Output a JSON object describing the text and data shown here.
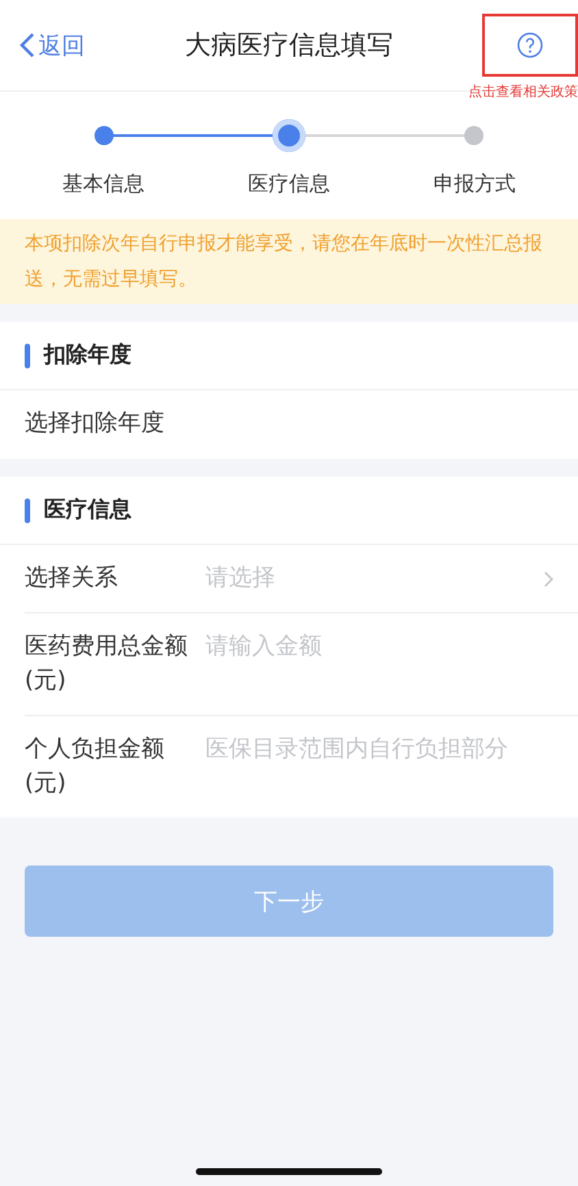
{
  "nav": {
    "back": "返回",
    "title": "大病医疗信息填写",
    "help_note": "点击查看相关政策"
  },
  "steps": [
    {
      "label": "基本信息",
      "completed": true,
      "selected": false
    },
    {
      "label": "医疗信息",
      "completed": false,
      "selected": true
    },
    {
      "label": "申报方式",
      "completed": false,
      "selected": false
    }
  ],
  "notice": "本项扣除次年自行申报才能享受，请您在年底时一次性汇总报送，无需过早填写。",
  "sections": [
    {
      "title": "扣除年度",
      "rows": [
        {
          "kind": "plain",
          "label": "选择扣除年度"
        }
      ]
    },
    {
      "title": "医疗信息",
      "rows": [
        {
          "kind": "select",
          "label": "选择关系",
          "placeholder": "请选择"
        },
        {
          "kind": "input",
          "label": "医药费用总金额(元)",
          "placeholder": "请输入金额"
        },
        {
          "kind": "input",
          "label": "个人负担金额(元)",
          "placeholder": "医保目录范围内自行负担部分"
        }
      ]
    }
  ],
  "next_button": {
    "label": "下一步",
    "disabled": true
  }
}
